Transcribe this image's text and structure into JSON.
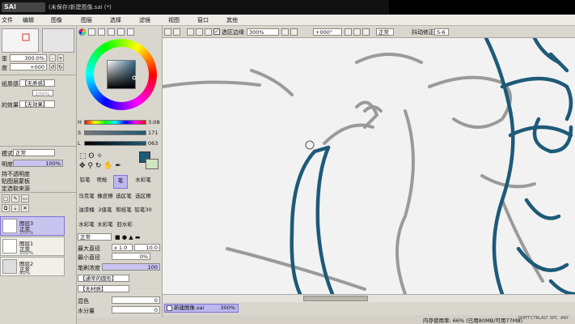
{
  "app": {
    "logo": "SAI",
    "window_title": "(未保存)新建图像.sai (*)"
  },
  "menu": [
    "文件",
    "编辑",
    "图像",
    "图层",
    "选择",
    "滤镜",
    "视图",
    "窗口",
    "其他"
  ],
  "navigator": {
    "zoom": "300.0%",
    "angle": "+000"
  },
  "layer_props": {
    "paper_texture_label": "纸质感",
    "paper_texture_value": "【无质感】",
    "paper_texture_pct": "100%",
    "effect_label": "的效果",
    "effect_value": "【无效果】",
    "blend_mode_label": "模式",
    "blend_mode_value": "正常",
    "opacity_label": "明度",
    "opacity_value": "100%",
    "options": [
      "持不透明度",
      "贴图层蒙板",
      "定选取来源"
    ]
  },
  "layers": [
    {
      "name": "图层3",
      "mode": "正常",
      "opacity": "100%",
      "selected": true
    },
    {
      "name": "图层1",
      "mode": "正常",
      "opacity": "100%",
      "selected": false
    },
    {
      "name": "图层2",
      "mode": "正常",
      "opacity": "40%",
      "selected": false
    }
  ],
  "color": {
    "h_label": "H",
    "h_value": "3:08",
    "s_label": "S",
    "s_value": "171",
    "v_label": "L",
    "v_value": "063",
    "current_color": "#1e5a78",
    "secondary_color": "#cfe6c0"
  },
  "tools": [
    [
      "铅笔",
      "喷枪",
      "笔",
      "水彩笔"
    ],
    [
      "马克笔",
      "橡皮擦",
      "选区笔",
      "选区擦"
    ],
    [
      "油漆桶",
      "2值笔",
      "和纸笔",
      "铅笔30"
    ],
    [
      "水彩笔",
      "水彩笔",
      "旧水彩"
    ]
  ],
  "active_tool": "笔",
  "brush": {
    "mode": "正常",
    "max_size_label": "最大直径",
    "max_size_mult": "x 1.0",
    "max_size_value": "10.0",
    "min_size_label": "最小直径",
    "min_size_value": "0%",
    "density_label": "笔刷浓度",
    "density_value": "100",
    "shape_value": "【通常的圆形】",
    "texture_value": "【无材质】",
    "blend_label": "混色",
    "blend_value": "0",
    "water_label": "水分量",
    "water_value": "0"
  },
  "canvas_toolbar": {
    "antialias_label": "选区边缘",
    "zoom": "300%",
    "angle": "+000°",
    "mode": "正常",
    "stabilizer_label": "抖动修正",
    "stabilizer_value": "S-6"
  },
  "document_tab": {
    "name": "新建图像.sai",
    "zoom": "300%"
  },
  "status": {
    "memory": "内存使用率: 66% (已用80MB/可用77MB)",
    "keys": [
      "SHIFT",
      "CTRL",
      "ALT",
      "SPC",
      "ANY"
    ]
  }
}
